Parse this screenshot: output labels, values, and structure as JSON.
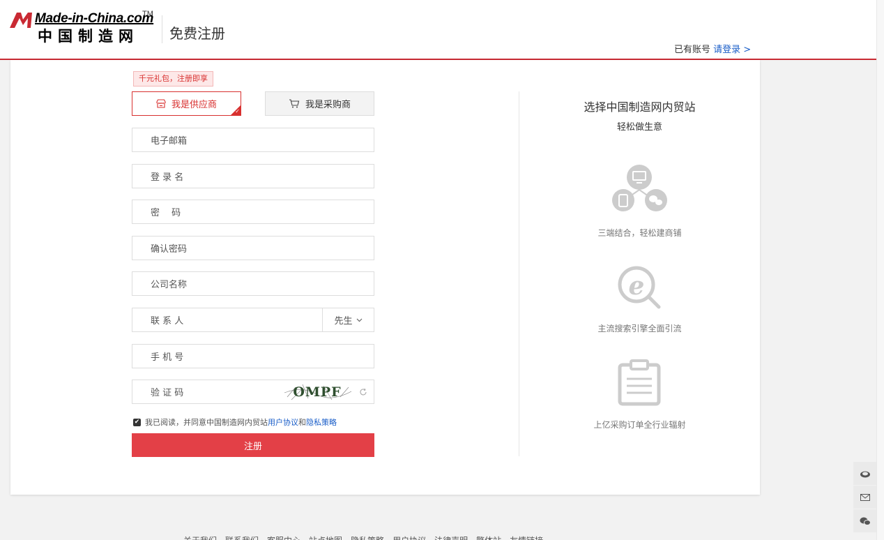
{
  "header": {
    "logo_en": "Made-in-China.com",
    "logo_tm": "TM",
    "logo_cn": "中国制造网",
    "page_title": "免费注册",
    "login_hint_prefix": "已有账号",
    "login_link": "请登录 >"
  },
  "promo_badge": "千元礼包，注册即享",
  "roles": [
    {
      "label": "我是供应商",
      "icon": "store-icon",
      "selected": true
    },
    {
      "label": "我是采购商",
      "icon": "cart-icon",
      "selected": false
    }
  ],
  "fields": {
    "email": "电子邮箱",
    "username": "登 录 名",
    "password": "密　 码",
    "confirm_password": "确认密码",
    "company": "公司名称",
    "contact": "联 系 人",
    "contact_title": "先生",
    "phone": "手 机 号",
    "captcha": "验 证 码",
    "captcha_text": "OMPF"
  },
  "agreement": {
    "prefix": "我已阅读，并同意中国制造网内贸站",
    "link1": "用户协议",
    "joiner": "和",
    "link2": "隐私策略",
    "checked": true
  },
  "submit_label": "注册",
  "side": {
    "title": "选择中国制造网内贸站",
    "subtitle": "轻松做生意",
    "features": [
      {
        "icon": "multi-device-icon",
        "text": "三端结合，轻松建商铺"
      },
      {
        "icon": "search-engine-icon",
        "text": "主流搜索引擎全面引流"
      },
      {
        "icon": "clipboard-icon",
        "text": "上亿采购订单全行业辐射"
      }
    ]
  },
  "footer_links": [
    "关于我们",
    "联系我们",
    "客服中心",
    "站点地图",
    "隐私策略",
    "用户协议",
    "法律声明",
    "繁体站",
    "友情链接"
  ],
  "colors": {
    "accent": "#e34047",
    "link": "#1a5ec8",
    "brand_red": "#c92a33"
  }
}
